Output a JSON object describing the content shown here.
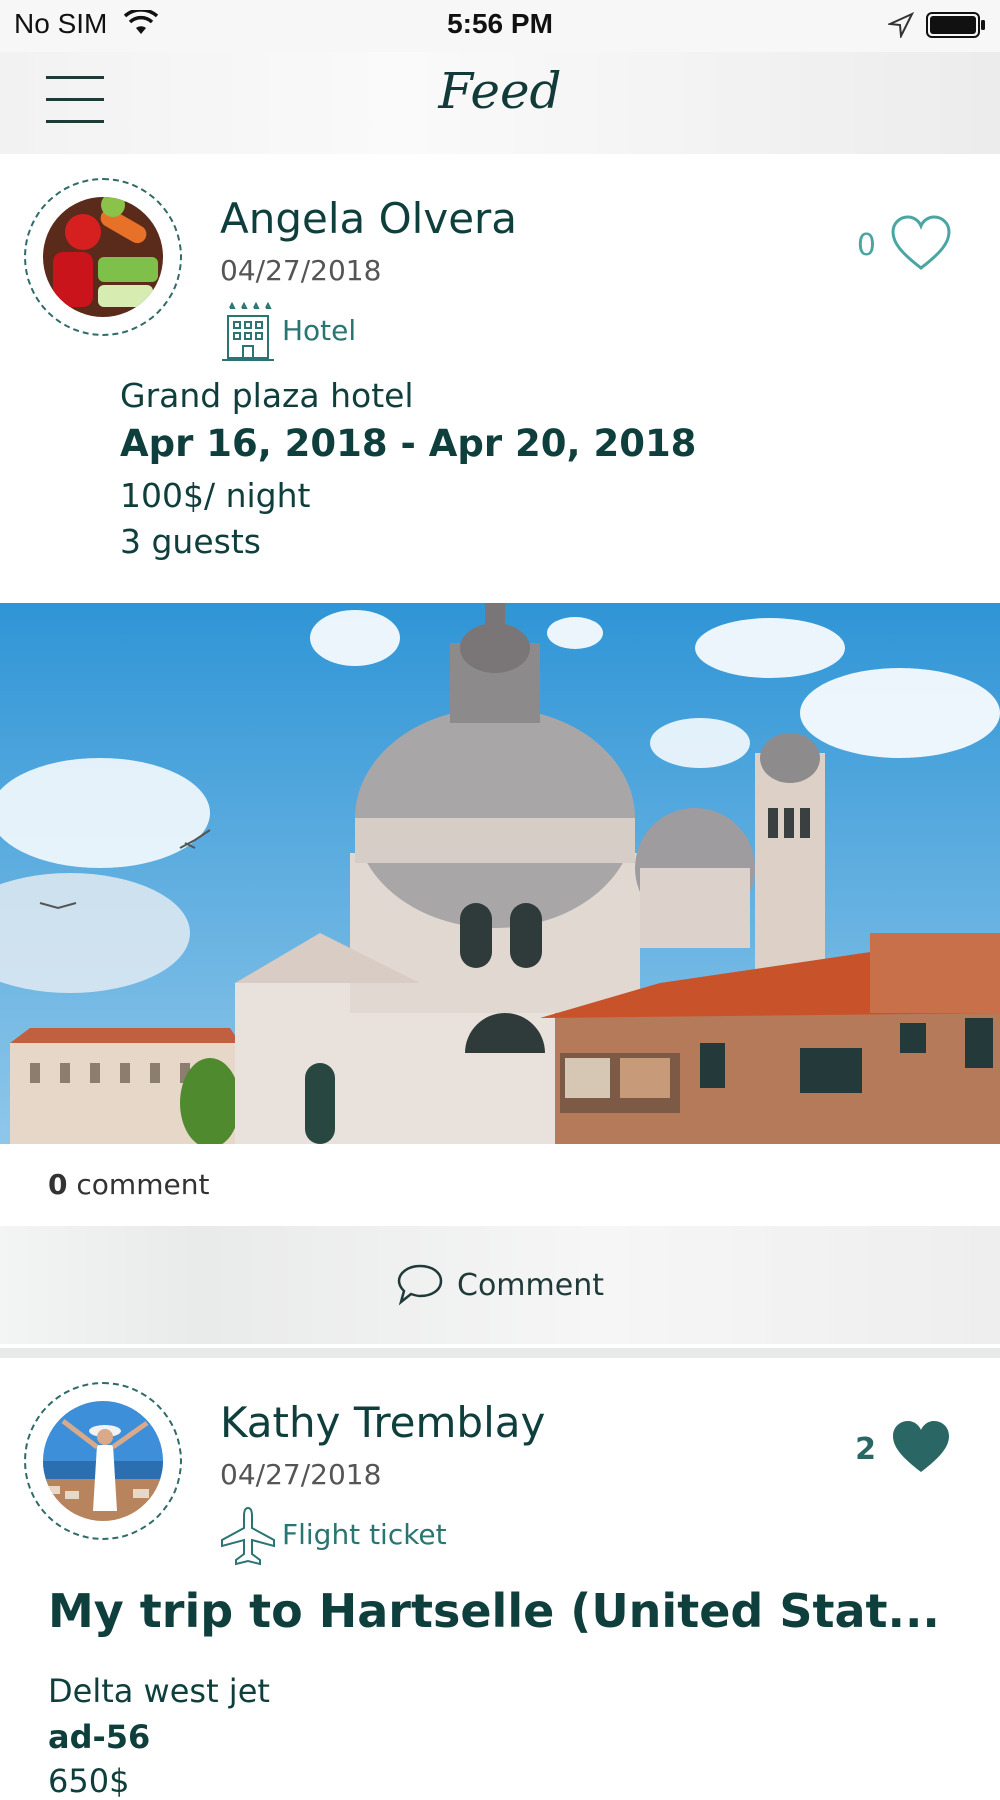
{
  "status_bar": {
    "carrier": "No SIM",
    "time": "5:56 PM"
  },
  "nav": {
    "title": "Feed",
    "menu_icon": "hamburger-menu-icon"
  },
  "posts": [
    {
      "user_name": "Angela Olvera",
      "date": "04/27/2018",
      "category": "Hotel",
      "category_icon": "hotel-icon",
      "like_count": "0",
      "liked": false,
      "place": "Grand plaza hotel",
      "dates_range": "Apr 16, 2018 - Apr 20, 2018",
      "price": "100$/ night",
      "guests": "3 guests",
      "comment_count": "0",
      "comment_label": "comment",
      "comment_button": "Comment"
    },
    {
      "user_name": "Kathy Tremblay",
      "date": "04/27/2018",
      "category": "Flight ticket",
      "category_icon": "airplane-icon",
      "like_count": "2",
      "liked": true,
      "title": "My trip to Hartselle (United Stat...",
      "airline": "Delta west jet",
      "flight_code": "ad-56",
      "price": "650$"
    }
  ],
  "colors": {
    "primary": "#0f3f3c",
    "accent": "#2a7572",
    "heart_outline": "#4aa6a2",
    "heart_filled": "#2a6663"
  }
}
